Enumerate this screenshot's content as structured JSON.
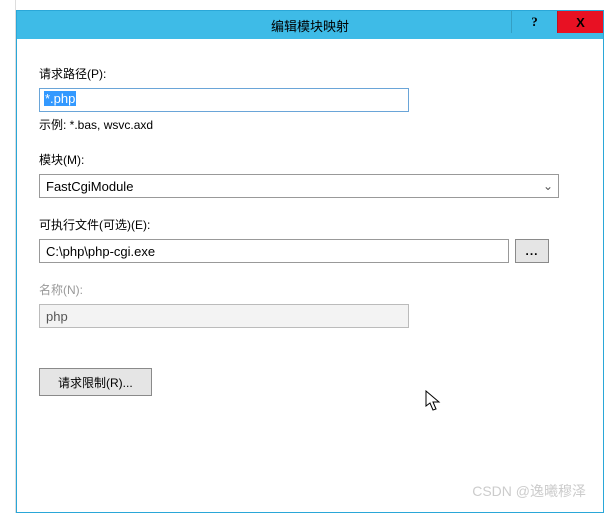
{
  "titlebar": {
    "title": "编辑模块映射",
    "help": "?",
    "close": "X"
  },
  "request_path": {
    "label": "请求路径(P):",
    "value": "*.php",
    "hint": "示例: *.bas, wsvc.axd"
  },
  "module": {
    "label": "模块(M):",
    "value": "FastCgiModule"
  },
  "executable": {
    "label": "可执行文件(可选)(E):",
    "value": "C:\\php\\php-cgi.exe",
    "browse": "..."
  },
  "name": {
    "label": "名称(N):",
    "value": "php"
  },
  "restrict_button": "请求限制(R)...",
  "watermark": "CSDN @逸曦穆泽"
}
